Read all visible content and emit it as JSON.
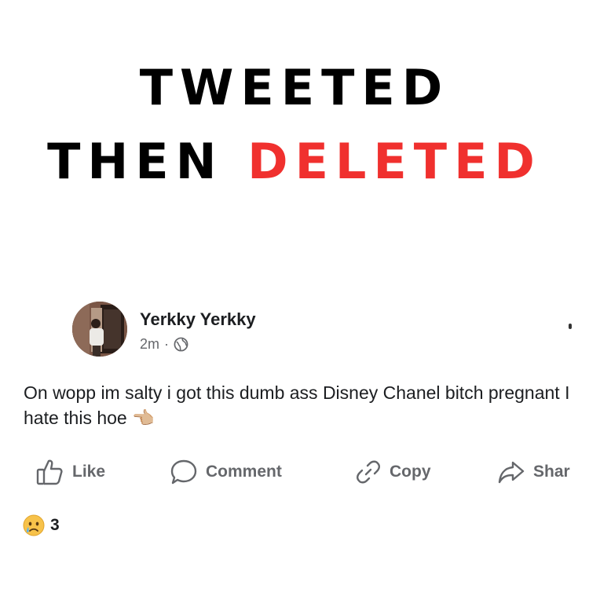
{
  "headline": {
    "line1": "TWEETED",
    "line2_black": "THEN",
    "line2_red": "DELETED"
  },
  "colors": {
    "headline_accent": "#f0302e",
    "text_primary": "#1c1e21",
    "text_secondary": "#65676b"
  },
  "post": {
    "author": "Yerkky Yerkky",
    "timestamp": "2m",
    "separator": "·",
    "privacy_icon": "globe-icon",
    "text": "On wopp im salty i got this dumb ass Disney Chanel bitch pregnant I hate this hoe",
    "text_emoji": "👈🏼",
    "actions": [
      {
        "label": "Like",
        "icon": "thumbs-up-icon"
      },
      {
        "label": "Comment",
        "icon": "comment-bubble-icon"
      },
      {
        "label": "Copy",
        "icon": "link-icon"
      },
      {
        "label": "Shar",
        "icon": "share-arrow-icon"
      }
    ],
    "reactions": {
      "icon": "sad-face-icon",
      "count": "3"
    }
  }
}
